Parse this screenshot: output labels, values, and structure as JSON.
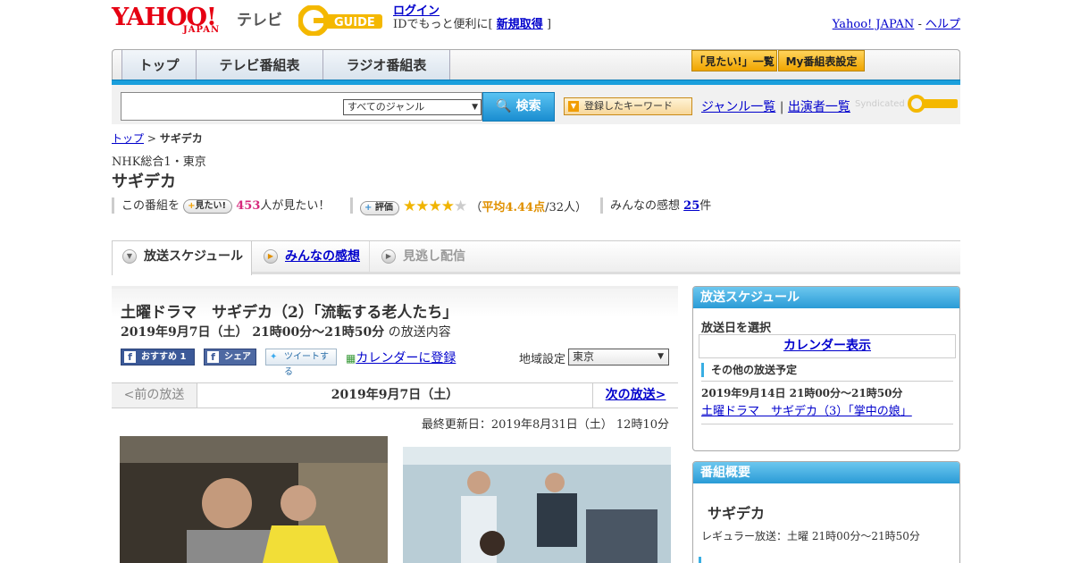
{
  "header": {
    "yahoo_logo": "YAHOO!",
    "yahoo_japan": "JAPAN",
    "tv_label": "テレビ",
    "gguide_logo": "GUIDE",
    "login_label": "ログイン",
    "login_prefix": "IDでもっと便利に[",
    "register_label": "新規取得",
    "login_suffix": "]",
    "yahoo_japan_link": "Yahoo! JAPAN",
    "separator": "-",
    "help_link": "ヘルプ"
  },
  "nav": {
    "tabs": [
      {
        "label": "トップ"
      },
      {
        "label": "テレビ番組表"
      },
      {
        "label": "ラジオ番組表"
      }
    ],
    "mitai_list_label": "「見たい!」一覧",
    "my_schedule_label": "My番組表設定"
  },
  "search": {
    "placeholder": "",
    "genre_value": "すべてのジャンル",
    "button_label": "検索",
    "keyword_button_label": "登録したキーワード",
    "genre_list_link": "ジャンル一覧",
    "link_separator": "|",
    "cast_list_link": "出演者一覧",
    "syndicated_label": "Syndicated"
  },
  "breadcrumb": {
    "top_link": "トップ",
    "separator": ">",
    "current": "サギデカ"
  },
  "program": {
    "channel": "NHK総合1・東京",
    "title": "サギデカ",
    "want_prefix": "この番組を",
    "mitai_button": "見たい!",
    "want_count": "453",
    "want_suffix": "人が見たい！",
    "rating_button": "評価",
    "rating_avg": "平均4.44点",
    "rating_users": "/32人",
    "rating_open": "（",
    "rating_close": "）",
    "rating_value": 4.44,
    "impressions_label": "みんなの感想",
    "impressions_count": "25",
    "impressions_suffix": "件"
  },
  "tabs": [
    {
      "label": "放送スケジュール",
      "active": true
    },
    {
      "label": "みんなの感想",
      "active": false
    },
    {
      "label": "見逃し配信",
      "active": false
    }
  ],
  "episode": {
    "title": "土曜ドラマ　サギデカ（2）「流転する老人たち」",
    "date_time": "2019年9月7日（土）  21時00分～21時50分",
    "date_suffix": "の放送内容",
    "fb_recommend": "おすすめ 1",
    "fb_share": "シェア",
    "tweet": "ツイートする",
    "calendar_link": "カレンダーに登録",
    "region_label": "地域設定",
    "region_value": "東京"
  },
  "pager": {
    "prev": "<前の放送",
    "current": "2019年9月7日（土）",
    "next": "次の放送>"
  },
  "updated": "最終更新日：2019年8月31日（土） 12時10分",
  "sidebar": {
    "schedule_header": "放送スケジュール",
    "select_date_label": "放送日を選択",
    "calendar_button": "カレンダー表示",
    "other_label": "その他の放送予定",
    "other_date": "2019年9月14日  21時00分～21時50分",
    "other_link": "土曜ドラマ　サギデカ（3）「掌中の娘」",
    "overview_header": "番組概要",
    "overview_title": "サギデカ",
    "regular_broadcast": "レギュラー放送：土曜 21時00分～21時50分"
  },
  "colors": {
    "accent": "#1a9fdc",
    "yahoo_red": "#e60012",
    "link": "#0000cc",
    "star": "#f0b400",
    "want_count": "#d6287c"
  }
}
